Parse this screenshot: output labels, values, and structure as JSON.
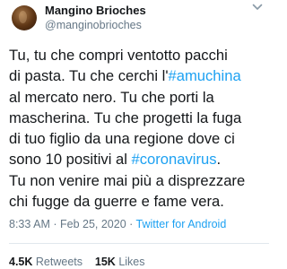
{
  "author": {
    "display_name": "Mangino Brioches",
    "handle": "@manginobrioches"
  },
  "tweet": {
    "lines": [
      [
        {
          "text": "Tu, tu che compri ventotto pacchi"
        }
      ],
      [
        {
          "text": "di pasta. Tu che cerchi l'"
        },
        {
          "text": "#amuchina",
          "hashtag": true
        }
      ],
      [
        {
          "text": "al mercato nero. Tu che porti la"
        }
      ],
      [
        {
          "text": "mascherina. Tu che progetti la fuga"
        }
      ],
      [
        {
          "text": "di tuo figlio da una regione dove ci"
        }
      ],
      [
        {
          "text": "sono 10 positivi al "
        },
        {
          "text": "#coronavirus",
          "hashtag": true
        },
        {
          "text": "."
        }
      ],
      [
        {
          "text": "Tu non venire mai più a disprezzare"
        }
      ],
      [
        {
          "text": "chi fugge da guerre e fame vera."
        }
      ]
    ]
  },
  "meta": {
    "time": "8:33 AM",
    "separator1": " · ",
    "date": "Feb 25, 2020",
    "separator2": " · ",
    "source": "Twitter for Android"
  },
  "stats": {
    "retweets_count": "4.5K",
    "retweets_label": "Retweets",
    "likes_count": "15K",
    "likes_label": "Likes"
  },
  "colors": {
    "hashtag": "#1da1f2",
    "secondary_text": "#657786",
    "divider": "#e1e8ed"
  },
  "icons": {
    "more_menu": "chevron-down-icon"
  }
}
